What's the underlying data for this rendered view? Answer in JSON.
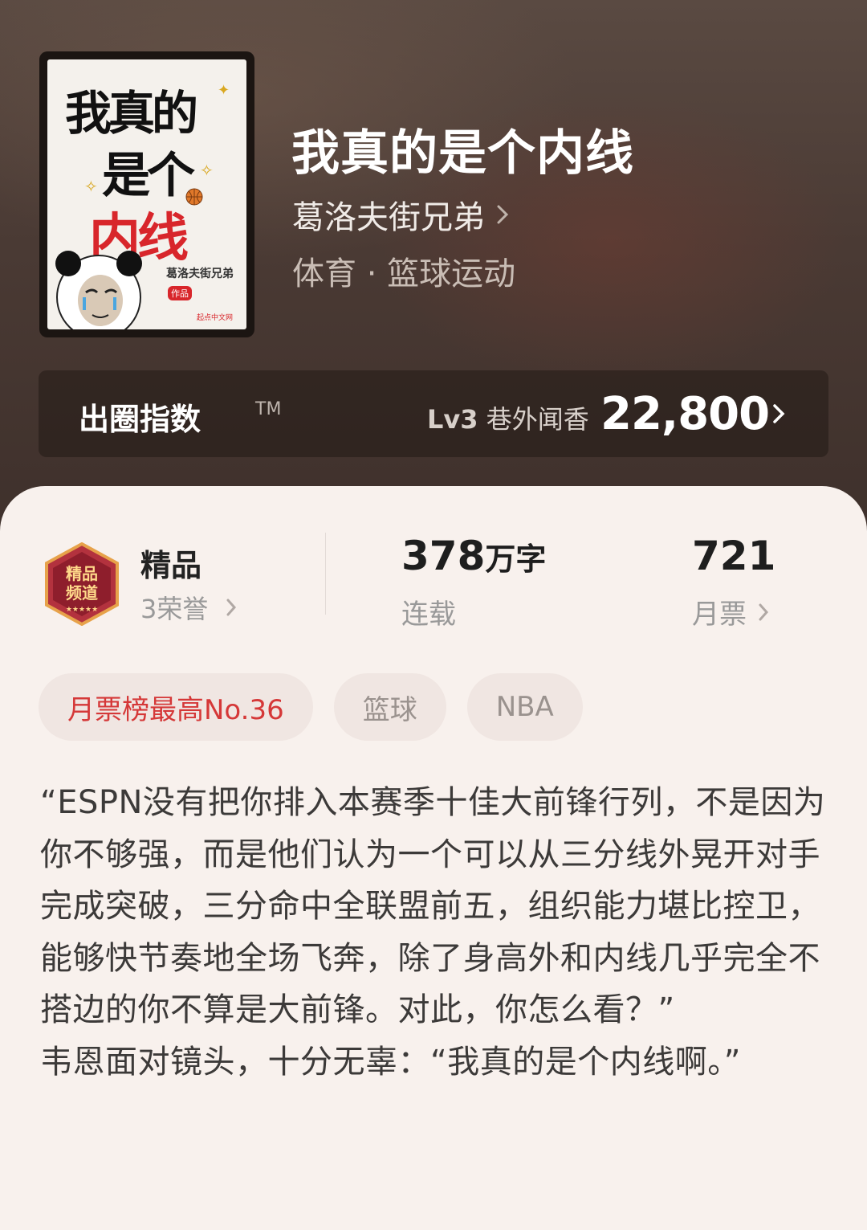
{
  "cover": {
    "title_line1": "我真的",
    "title_line2": "是个",
    "title_line3": "内线",
    "author": "葛洛夫街兄弟",
    "tag": "作品",
    "publisher": "起点中文网"
  },
  "book": {
    "title": "我真的是个内线",
    "author": "葛洛夫街兄弟",
    "genre": "体育 · 篮球运动"
  },
  "index": {
    "label": "出圈指数",
    "tm": "TM",
    "level": "Lv3",
    "level_name": "巷外闻香",
    "value": "22,800"
  },
  "stats": {
    "quality_title": "精品",
    "honors": "3荣誉",
    "words_number": "378",
    "words_unit": "万字",
    "status": "连载",
    "monthly_votes": "721",
    "monthly_label": "月票"
  },
  "tags": [
    {
      "label": "月票榜最高No.36"
    },
    {
      "label": "篮球"
    },
    {
      "label": "NBA"
    }
  ],
  "intro": {
    "paragraph1": "“ESPN没有把你排入本赛季十佳大前锋行列，不是因为你不够强，而是他们认为一个可以从三分线外晃开对手完成突破，三分命中全联盟前五，组织能力堪比控卫，能够快节奏地全场飞奔，除了身高外和内线几乎完全不搭边的你不算是大前锋。对此，你怎么看？”",
    "paragraph2": "韦恩面对镜头，十分无辜：“我真的是个内线啊。”"
  },
  "colors": {
    "accent_red": "#d53838",
    "hero_bg": "#4a3a34",
    "card_bg": "#f8f1ed"
  }
}
